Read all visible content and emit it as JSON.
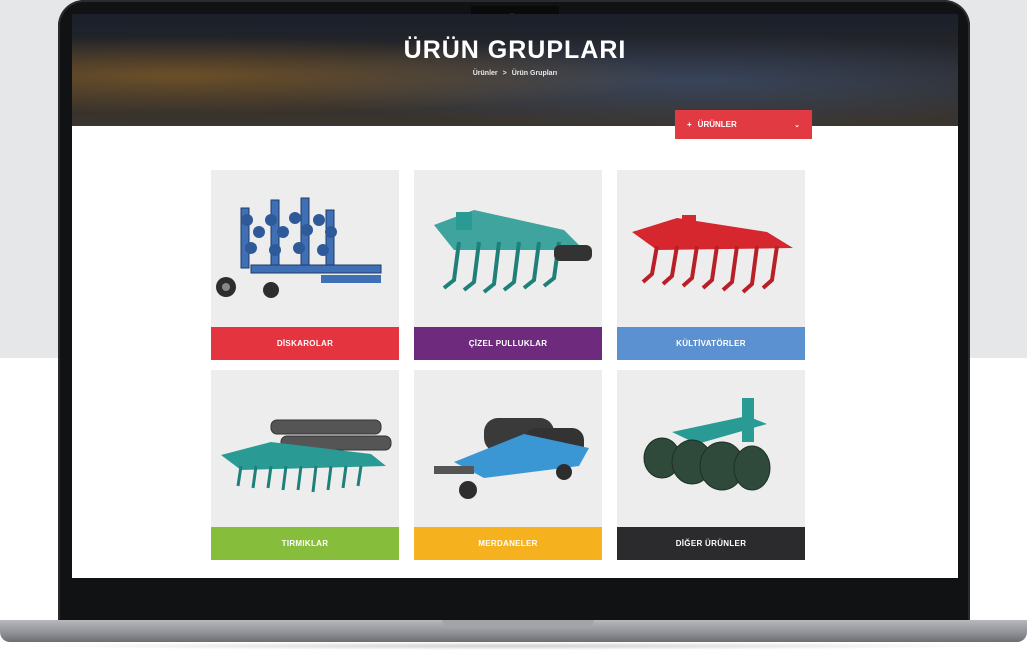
{
  "hero": {
    "title": "ÜRÜN GRUPLARI",
    "breadcrumb": [
      {
        "label": "Ürünler"
      },
      {
        "label": "Ürün Grupları"
      }
    ],
    "breadcrumb_sep": ">"
  },
  "dropdown": {
    "label": "ÜRÜNLER",
    "prefix_icon": "plus-icon",
    "suffix_icon": "chevron-down-icon"
  },
  "products": [
    {
      "label": "DİSKAROLAR",
      "color": "#e3343f",
      "image": "disc-harrow-image"
    },
    {
      "label": "ÇİZEL PULLUKLAR",
      "color": "#6e2a7c",
      "image": "chisel-plough-image"
    },
    {
      "label": "KÜLTİVATÖRLER",
      "color": "#5b91d0",
      "image": "cultivator-image"
    },
    {
      "label": "TIRMIKLAR",
      "color": "#86bd3b",
      "image": "harrow-image"
    },
    {
      "label": "MERDANELER",
      "color": "#f5b21e",
      "image": "roller-image"
    },
    {
      "label": "DİĞER ÜRÜNLER",
      "color": "#2b2b2d",
      "image": "other-products-image"
    }
  ]
}
